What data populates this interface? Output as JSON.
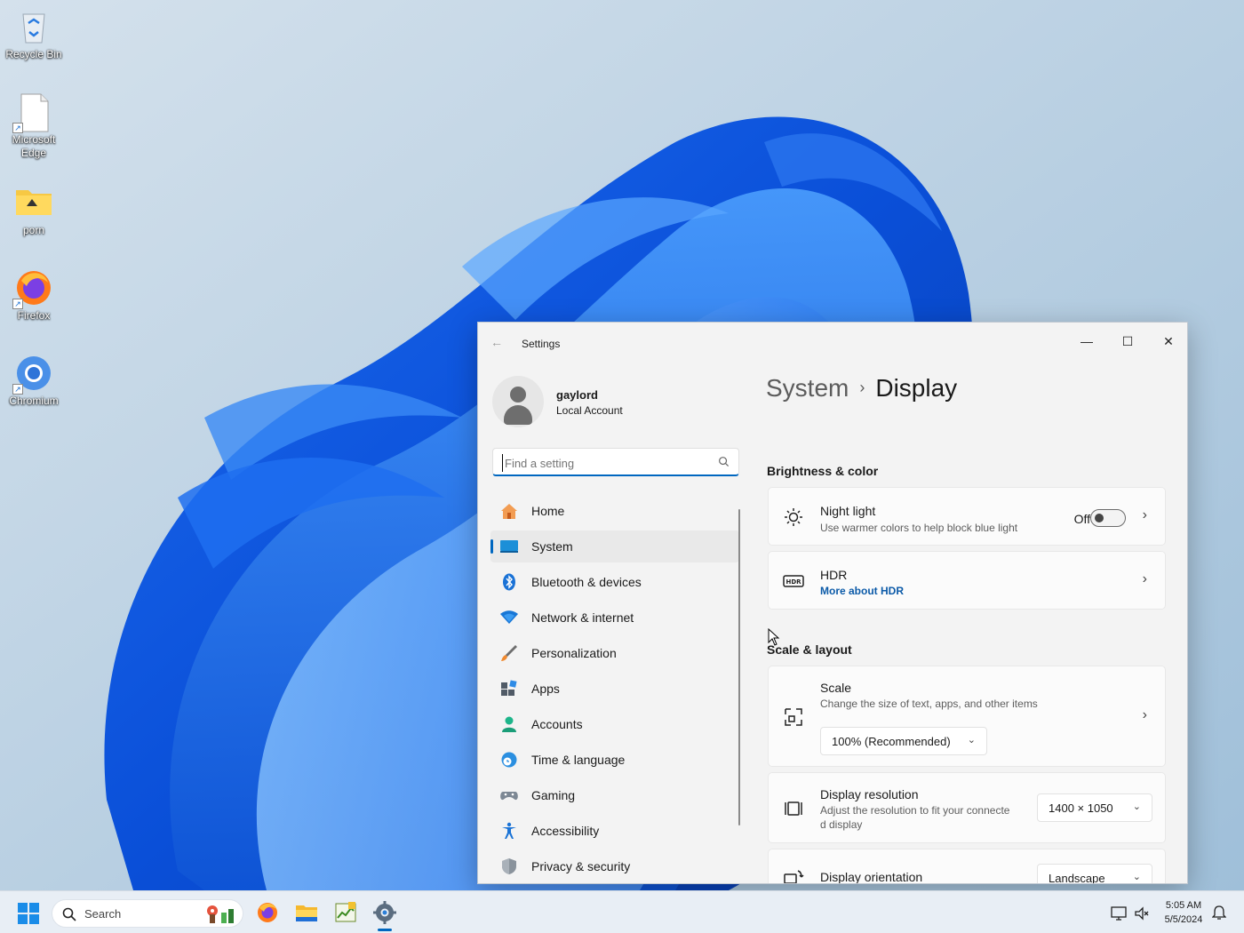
{
  "desktop": {
    "icons": [
      {
        "label": "Recycle Bin"
      },
      {
        "label": "Microsoft Edge"
      },
      {
        "label": "porn"
      },
      {
        "label": "Firefox"
      },
      {
        "label": "Chromium"
      }
    ]
  },
  "window": {
    "title": "Settings",
    "controls": {
      "minimize": "—",
      "maximize": "☐",
      "close": "✕"
    }
  },
  "profile": {
    "name": "gaylord",
    "type": "Local Account"
  },
  "search": {
    "placeholder": "Find a setting"
  },
  "nav": {
    "items": [
      {
        "label": "Home",
        "icon": "home-icon"
      },
      {
        "label": "System",
        "icon": "system-icon",
        "active": true
      },
      {
        "label": "Bluetooth & devices",
        "icon": "bluetooth-icon"
      },
      {
        "label": "Network & internet",
        "icon": "wifi-icon"
      },
      {
        "label": "Personalization",
        "icon": "brush-icon"
      },
      {
        "label": "Apps",
        "icon": "apps-icon"
      },
      {
        "label": "Accounts",
        "icon": "accounts-icon"
      },
      {
        "label": "Time & language",
        "icon": "globe-clock-icon"
      },
      {
        "label": "Gaming",
        "icon": "gamepad-icon"
      },
      {
        "label": "Accessibility",
        "icon": "accessibility-icon"
      },
      {
        "label": "Privacy & security",
        "icon": "shield-icon"
      }
    ]
  },
  "breadcrumb": {
    "parent": "System",
    "separator": "›",
    "current": "Display"
  },
  "brightness": {
    "heading": "Brightness & color",
    "night_light": {
      "title": "Night light",
      "subtitle": "Use warmer colors to help block blue light",
      "state": "Off"
    },
    "hdr": {
      "title": "HDR",
      "link": "More about HDR"
    }
  },
  "scale_layout": {
    "heading": "Scale & layout",
    "scale": {
      "title": "Scale",
      "subtitle": "Change the size of text, apps, and other items",
      "value": "100% (Recommended)"
    },
    "resolution": {
      "title": "Display resolution",
      "subtitle_1": "Adjust the resolution to fit your connecte",
      "subtitle_2": "d display",
      "value": "1400 × 1050"
    },
    "orientation": {
      "title": "Display orientation",
      "value": "Landscape"
    }
  },
  "taskbar": {
    "search_label": "Search",
    "time": "5:05 AM",
    "date": "5/5/2024"
  },
  "colors": {
    "accent": "#0067c0",
    "link": "#0b5aa8"
  }
}
